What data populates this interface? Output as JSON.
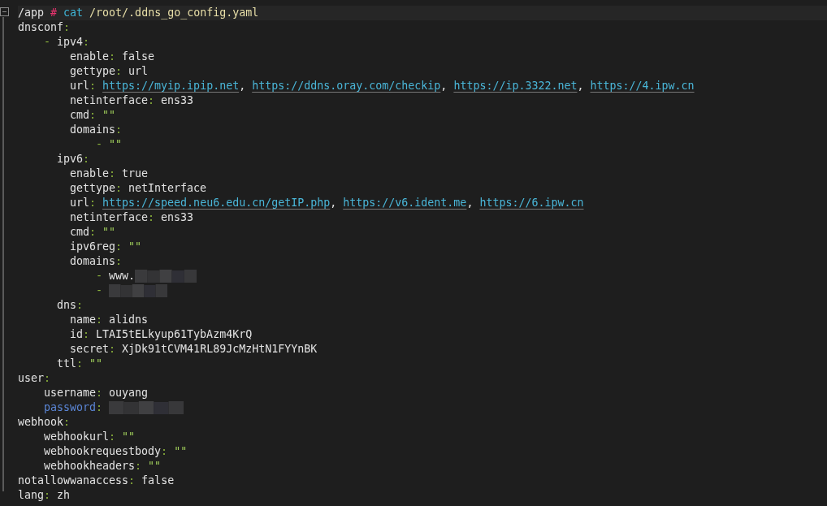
{
  "syntax": {
    "colon": ":",
    "dash": "-",
    "comma": ","
  },
  "prompt": {
    "path": "/app",
    "symbol": "#",
    "command": "cat",
    "argument": "/root/.ddns_go_config.yaml"
  },
  "document": [
    {
      "key": "dnsconf",
      "items": [
        {
          "entries": [
            {
              "key": "ipv4",
              "children": [
                {
                  "key": "enable",
                  "value": "false"
                },
                {
                  "key": "gettype",
                  "value": "url"
                },
                {
                  "key": "url",
                  "links": [
                    "https://myip.ipip.net",
                    "https://ddns.oray.com/checkip",
                    "https://ip.3322.net",
                    "https://4.ipw.cn"
                  ]
                },
                {
                  "key": "netinterface",
                  "value": "ens33"
                },
                {
                  "key": "cmd",
                  "value": "\"\"",
                  "kind": "quoted"
                },
                {
                  "key": "domains",
                  "items": [
                    {
                      "value": "\"\"",
                      "kind": "quoted"
                    }
                  ]
                }
              ]
            },
            {
              "key": "ipv6",
              "children": [
                {
                  "key": "enable",
                  "value": "true"
                },
                {
                  "key": "gettype",
                  "value": "netInterface"
                },
                {
                  "key": "url",
                  "links": [
                    "https://speed.neu6.edu.cn/getIP.php",
                    "https://v6.ident.me",
                    "https://6.ipw.cn"
                  ]
                },
                {
                  "key": "netinterface",
                  "value": "ens33"
                },
                {
                  "key": "cmd",
                  "value": "\"\"",
                  "kind": "quoted"
                },
                {
                  "key": "ipv6reg",
                  "value": "\"\"",
                  "kind": "quoted"
                },
                {
                  "key": "domains",
                  "items": [
                    {
                      "value": "www.",
                      "redacted": true
                    },
                    {
                      "redacted": true
                    }
                  ]
                }
              ]
            },
            {
              "key": "dns",
              "children": [
                {
                  "key": "name",
                  "value": "alidns"
                },
                {
                  "key": "id",
                  "value": "LTAI5tELkyup61TybAzm4KrQ"
                },
                {
                  "key": "secret",
                  "value": "XjDk91tCVM41RL89JcMzHtN1FYYnBK"
                }
              ]
            },
            {
              "key": "ttl",
              "value": "\"\"",
              "kind": "quoted"
            }
          ]
        }
      ]
    },
    {
      "key": "user",
      "children": [
        {
          "key": "username",
          "value": "ouyang"
        },
        {
          "key": "password",
          "kind": "keyword",
          "redacted": true
        }
      ]
    },
    {
      "key": "webhook",
      "children": [
        {
          "key": "webhookurl",
          "value": "\"\"",
          "kind": "quoted"
        },
        {
          "key": "webhookrequestbody",
          "value": "\"\"",
          "kind": "quoted"
        },
        {
          "key": "webhookheaders",
          "value": "\"\"",
          "kind": "quoted"
        }
      ]
    },
    {
      "key": "notallowwanaccess",
      "value": "false"
    },
    {
      "key": "lang",
      "value": "zh"
    }
  ]
}
